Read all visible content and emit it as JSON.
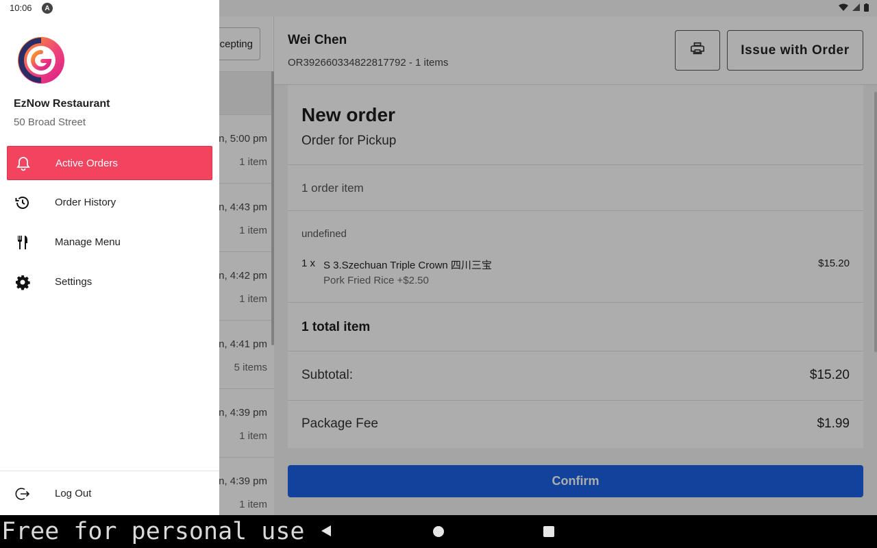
{
  "status_bar": {
    "time": "10:06"
  },
  "drawer": {
    "restaurant_name": "EzNow Restaurant",
    "restaurant_address": "50 Broad Street",
    "menu": [
      {
        "label": "Active Orders",
        "icon": "bell-icon",
        "active": true
      },
      {
        "label": "Order History",
        "icon": "history-icon",
        "active": false
      },
      {
        "label": "Manage Menu",
        "icon": "fork-knife-icon",
        "active": false
      },
      {
        "label": "Settings",
        "icon": "gear-icon",
        "active": false
      }
    ],
    "logout_label": "Log Out",
    "accent_color": "#f2445f"
  },
  "order_list": {
    "accept_button_label": "cepting",
    "orders": [
      {
        "time": "n, 5:00 pm",
        "count": "1 item"
      },
      {
        "time": "n, 4:43 pm",
        "count": "1 item"
      },
      {
        "time": "n, 4:42 pm",
        "count": "1 item"
      },
      {
        "time": "n, 4:41 pm",
        "count": "5 items"
      },
      {
        "time": "n, 4:39 pm",
        "count": "1 item"
      },
      {
        "time": "n, 4:39 pm",
        "count": "1 item"
      }
    ]
  },
  "order_detail": {
    "customer_name": "Wei Chen",
    "order_id_line": "OR392660334822817792 - 1 items",
    "issue_button_label": "Issue with Order",
    "title": "New order",
    "order_type": "Order for Pickup",
    "order_item_count": "1 order item",
    "section_label": "undefined",
    "line_item": {
      "qty": "1 x",
      "name": "S 3.Szechuan Triple Crown 四川三宝",
      "option": "Pork Fried Rice +$2.50",
      "price": "$15.20"
    },
    "total_items": "1 total item",
    "subtotal_label": "Subtotal:",
    "subtotal_value": "$15.20",
    "package_fee_label": "Package Fee",
    "package_fee_value": "$1.99",
    "confirm_label": "Confirm",
    "confirm_color": "#1a62e6"
  },
  "nav_bar": {
    "watermark": "Free for personal use"
  }
}
